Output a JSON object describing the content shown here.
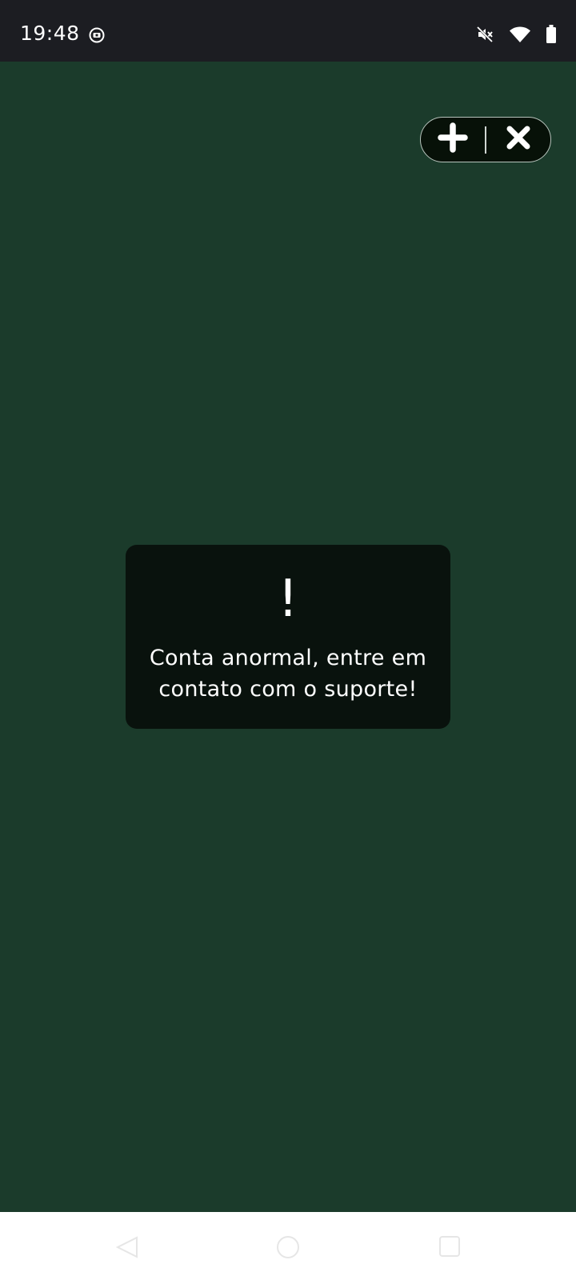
{
  "status_bar": {
    "time": "19:48",
    "icons": [
      "notification-icon",
      "mute-icon",
      "wifi-icon",
      "battery-icon"
    ]
  },
  "capsule": {
    "icons": [
      "plus-icon",
      "close-icon"
    ]
  },
  "toast": {
    "icon": "!",
    "message": "Conta anormal, entre em contato com o suporte!"
  },
  "nav_bar": {
    "icons": [
      "back-icon",
      "home-icon",
      "recents-icon"
    ]
  },
  "colors": {
    "background": "#1b3b2b",
    "status_bar": "#1c1d22",
    "toast_background": "#09120d",
    "capsule_background": "#071108"
  }
}
